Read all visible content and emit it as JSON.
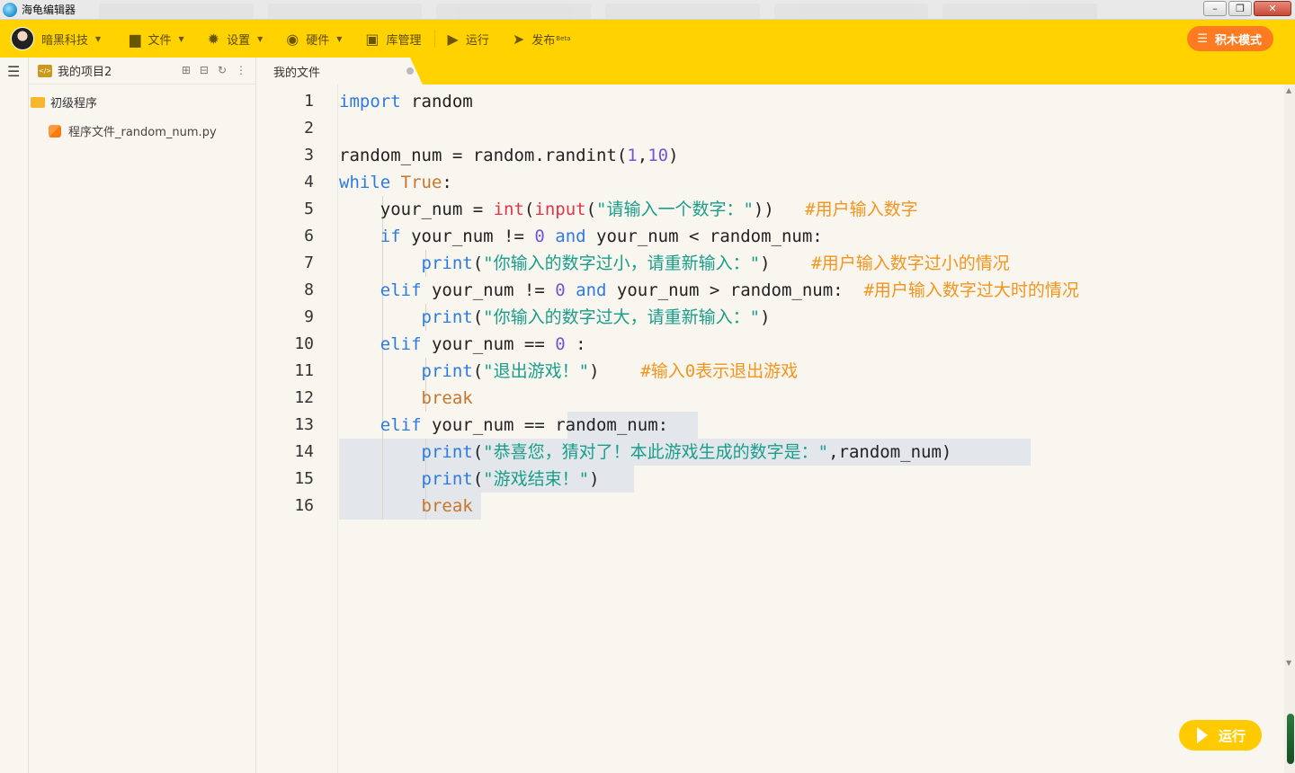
{
  "window": {
    "title": "海龟编辑器"
  },
  "toolbar": {
    "user": "暗黑科技",
    "file": "文件",
    "settings": "设置",
    "hardware": "硬件",
    "library": "库管理",
    "run": "运行",
    "publish": "发布",
    "publish_badge": "Beta",
    "mode_button": "积木模式"
  },
  "sidebar": {
    "project_title": "我的项目2",
    "folder": "初级程序",
    "file": "程序文件_random_num.py"
  },
  "tab": {
    "label": "我的文件"
  },
  "run_fab": "运行",
  "code": {
    "line_numbers": [
      "1",
      "2",
      "3",
      "4",
      "5",
      "6",
      "7",
      "8",
      "9",
      "10",
      "11",
      "12",
      "13",
      "14",
      "15",
      "16"
    ],
    "l1": [
      "import",
      " random"
    ],
    "l3": [
      "random_num = random.randint(",
      "1",
      ",",
      "10",
      ")"
    ],
    "l4": [
      "while",
      " ",
      "True",
      ":"
    ],
    "l5": [
      "    your_num = ",
      "int",
      "(",
      "input",
      "(",
      "\"请输入一个数字：\"",
      "))   ",
      "#用户输入数字"
    ],
    "l6": [
      "    ",
      "if",
      " your_num != ",
      "0",
      " ",
      "and",
      " your_num < random_num:"
    ],
    "l7": [
      "        ",
      "print",
      "(",
      "\"你输入的数字过小，请重新输入：\"",
      ")    ",
      "#用户输入数字过小的情况"
    ],
    "l8": [
      "    ",
      "elif",
      " your_num != ",
      "0",
      " ",
      "and",
      " your_num > random_num:  ",
      "#用户输入数字过大时的情况"
    ],
    "l9": [
      "        ",
      "print",
      "(",
      "\"你输入的数字过大，请重新输入：\"",
      ")"
    ],
    "l10": [
      "    ",
      "elif",
      " your_num == ",
      "0",
      " :"
    ],
    "l11": [
      "        ",
      "print",
      "(",
      "\"退出游戏！\"",
      ")    ",
      "#输入0表示退出游戏"
    ],
    "l12": [
      "        ",
      "break"
    ],
    "l13": [
      "    ",
      "elif",
      " your_num == random_num:"
    ],
    "l14": [
      "        ",
      "print",
      "(",
      "\"恭喜您，猜对了！本此游戏生成的数字是：\"",
      ",random_num)"
    ],
    "l15": [
      "        ",
      "print",
      "(",
      "\"游戏结束！\"",
      ")"
    ],
    "l16": [
      "        ",
      "break"
    ]
  }
}
